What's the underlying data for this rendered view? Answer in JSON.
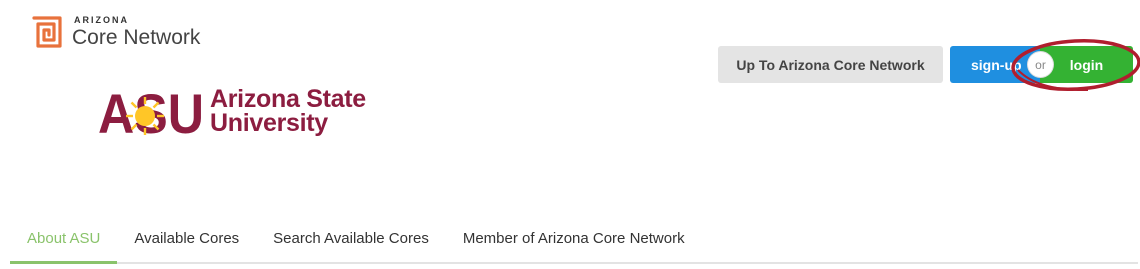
{
  "brand": {
    "small_text": "ARIZONA",
    "big_text": "Core Network",
    "icon": "spiral-logo-icon",
    "color": "#e8723c"
  },
  "institution": {
    "logo_letters": "ASU",
    "name_line1": "Arizona State",
    "name_line2": "University",
    "maroon": "#8C1D40",
    "gold": "#FFC627"
  },
  "header": {
    "up_button_label": "Up To Arizona Core Network",
    "signup_label": "sign-up",
    "or_label": "or",
    "login_label": "login",
    "annotation": "red-circle-highlight-around-login"
  },
  "nav": {
    "tabs": [
      {
        "label": "About ASU",
        "active": true
      },
      {
        "label": "Available Cores",
        "active": false
      },
      {
        "label": "Search Available Cores",
        "active": false
      },
      {
        "label": "Member of Arizona Core Network",
        "active": false
      }
    ]
  },
  "colors": {
    "signup_blue": "#1f8fe0",
    "login_green": "#34b233",
    "active_tab_green": "#8ac36b",
    "annotation_red": "#b01e2e"
  }
}
